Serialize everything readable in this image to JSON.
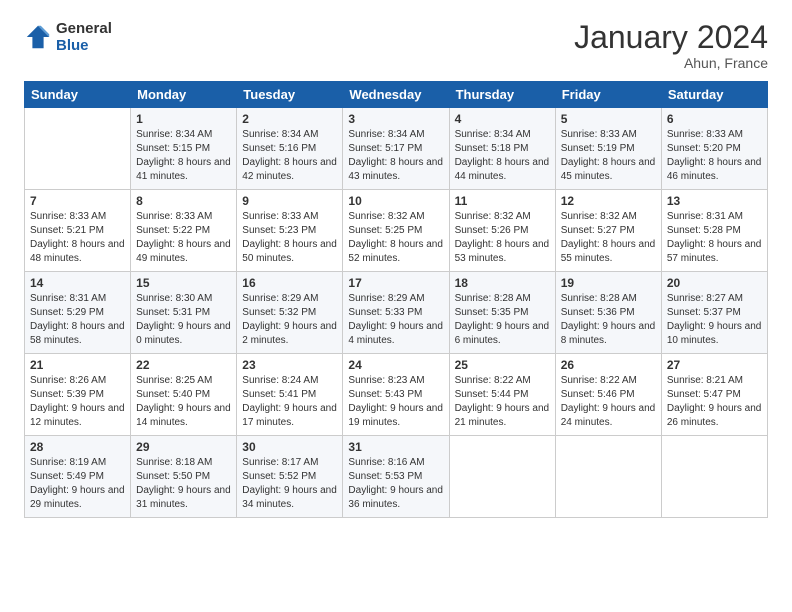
{
  "header": {
    "logo_line1": "General",
    "logo_line2": "Blue",
    "month_title": "January 2024",
    "location": "Ahun, France"
  },
  "days_of_week": [
    "Sunday",
    "Monday",
    "Tuesday",
    "Wednesday",
    "Thursday",
    "Friday",
    "Saturday"
  ],
  "weeks": [
    [
      {
        "day": "",
        "sunrise": "",
        "sunset": "",
        "daylight": ""
      },
      {
        "day": "1",
        "sunrise": "Sunrise: 8:34 AM",
        "sunset": "Sunset: 5:15 PM",
        "daylight": "Daylight: 8 hours and 41 minutes."
      },
      {
        "day": "2",
        "sunrise": "Sunrise: 8:34 AM",
        "sunset": "Sunset: 5:16 PM",
        "daylight": "Daylight: 8 hours and 42 minutes."
      },
      {
        "day": "3",
        "sunrise": "Sunrise: 8:34 AM",
        "sunset": "Sunset: 5:17 PM",
        "daylight": "Daylight: 8 hours and 43 minutes."
      },
      {
        "day": "4",
        "sunrise": "Sunrise: 8:34 AM",
        "sunset": "Sunset: 5:18 PM",
        "daylight": "Daylight: 8 hours and 44 minutes."
      },
      {
        "day": "5",
        "sunrise": "Sunrise: 8:33 AM",
        "sunset": "Sunset: 5:19 PM",
        "daylight": "Daylight: 8 hours and 45 minutes."
      },
      {
        "day": "6",
        "sunrise": "Sunrise: 8:33 AM",
        "sunset": "Sunset: 5:20 PM",
        "daylight": "Daylight: 8 hours and 46 minutes."
      }
    ],
    [
      {
        "day": "7",
        "sunrise": "Sunrise: 8:33 AM",
        "sunset": "Sunset: 5:21 PM",
        "daylight": "Daylight: 8 hours and 48 minutes."
      },
      {
        "day": "8",
        "sunrise": "Sunrise: 8:33 AM",
        "sunset": "Sunset: 5:22 PM",
        "daylight": "Daylight: 8 hours and 49 minutes."
      },
      {
        "day": "9",
        "sunrise": "Sunrise: 8:33 AM",
        "sunset": "Sunset: 5:23 PM",
        "daylight": "Daylight: 8 hours and 50 minutes."
      },
      {
        "day": "10",
        "sunrise": "Sunrise: 8:32 AM",
        "sunset": "Sunset: 5:25 PM",
        "daylight": "Daylight: 8 hours and 52 minutes."
      },
      {
        "day": "11",
        "sunrise": "Sunrise: 8:32 AM",
        "sunset": "Sunset: 5:26 PM",
        "daylight": "Daylight: 8 hours and 53 minutes."
      },
      {
        "day": "12",
        "sunrise": "Sunrise: 8:32 AM",
        "sunset": "Sunset: 5:27 PM",
        "daylight": "Daylight: 8 hours and 55 minutes."
      },
      {
        "day": "13",
        "sunrise": "Sunrise: 8:31 AM",
        "sunset": "Sunset: 5:28 PM",
        "daylight": "Daylight: 8 hours and 57 minutes."
      }
    ],
    [
      {
        "day": "14",
        "sunrise": "Sunrise: 8:31 AM",
        "sunset": "Sunset: 5:29 PM",
        "daylight": "Daylight: 8 hours and 58 minutes."
      },
      {
        "day": "15",
        "sunrise": "Sunrise: 8:30 AM",
        "sunset": "Sunset: 5:31 PM",
        "daylight": "Daylight: 9 hours and 0 minutes."
      },
      {
        "day": "16",
        "sunrise": "Sunrise: 8:29 AM",
        "sunset": "Sunset: 5:32 PM",
        "daylight": "Daylight: 9 hours and 2 minutes."
      },
      {
        "day": "17",
        "sunrise": "Sunrise: 8:29 AM",
        "sunset": "Sunset: 5:33 PM",
        "daylight": "Daylight: 9 hours and 4 minutes."
      },
      {
        "day": "18",
        "sunrise": "Sunrise: 8:28 AM",
        "sunset": "Sunset: 5:35 PM",
        "daylight": "Daylight: 9 hours and 6 minutes."
      },
      {
        "day": "19",
        "sunrise": "Sunrise: 8:28 AM",
        "sunset": "Sunset: 5:36 PM",
        "daylight": "Daylight: 9 hours and 8 minutes."
      },
      {
        "day": "20",
        "sunrise": "Sunrise: 8:27 AM",
        "sunset": "Sunset: 5:37 PM",
        "daylight": "Daylight: 9 hours and 10 minutes."
      }
    ],
    [
      {
        "day": "21",
        "sunrise": "Sunrise: 8:26 AM",
        "sunset": "Sunset: 5:39 PM",
        "daylight": "Daylight: 9 hours and 12 minutes."
      },
      {
        "day": "22",
        "sunrise": "Sunrise: 8:25 AM",
        "sunset": "Sunset: 5:40 PM",
        "daylight": "Daylight: 9 hours and 14 minutes."
      },
      {
        "day": "23",
        "sunrise": "Sunrise: 8:24 AM",
        "sunset": "Sunset: 5:41 PM",
        "daylight": "Daylight: 9 hours and 17 minutes."
      },
      {
        "day": "24",
        "sunrise": "Sunrise: 8:23 AM",
        "sunset": "Sunset: 5:43 PM",
        "daylight": "Daylight: 9 hours and 19 minutes."
      },
      {
        "day": "25",
        "sunrise": "Sunrise: 8:22 AM",
        "sunset": "Sunset: 5:44 PM",
        "daylight": "Daylight: 9 hours and 21 minutes."
      },
      {
        "day": "26",
        "sunrise": "Sunrise: 8:22 AM",
        "sunset": "Sunset: 5:46 PM",
        "daylight": "Daylight: 9 hours and 24 minutes."
      },
      {
        "day": "27",
        "sunrise": "Sunrise: 8:21 AM",
        "sunset": "Sunset: 5:47 PM",
        "daylight": "Daylight: 9 hours and 26 minutes."
      }
    ],
    [
      {
        "day": "28",
        "sunrise": "Sunrise: 8:19 AM",
        "sunset": "Sunset: 5:49 PM",
        "daylight": "Daylight: 9 hours and 29 minutes."
      },
      {
        "day": "29",
        "sunrise": "Sunrise: 8:18 AM",
        "sunset": "Sunset: 5:50 PM",
        "daylight": "Daylight: 9 hours and 31 minutes."
      },
      {
        "day": "30",
        "sunrise": "Sunrise: 8:17 AM",
        "sunset": "Sunset: 5:52 PM",
        "daylight": "Daylight: 9 hours and 34 minutes."
      },
      {
        "day": "31",
        "sunrise": "Sunrise: 8:16 AM",
        "sunset": "Sunset: 5:53 PM",
        "daylight": "Daylight: 9 hours and 36 minutes."
      },
      {
        "day": "",
        "sunrise": "",
        "sunset": "",
        "daylight": ""
      },
      {
        "day": "",
        "sunrise": "",
        "sunset": "",
        "daylight": ""
      },
      {
        "day": "",
        "sunrise": "",
        "sunset": "",
        "daylight": ""
      }
    ]
  ]
}
